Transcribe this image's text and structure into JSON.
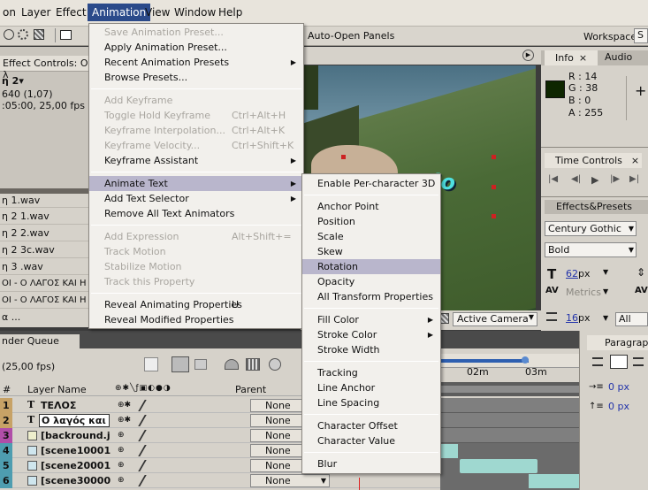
{
  "menubar": {
    "items": [
      "on",
      "Layer",
      "Effect",
      "Animation",
      "View",
      "Window",
      "Help"
    ],
    "active": "Animation"
  },
  "toolbar": {
    "auto_open_panels": "Auto-Open Panels",
    "workspace_label": "Workspace:",
    "workspace_value": "S"
  },
  "effect_controls": {
    "tab_title": "Effect Controls: Ο λ",
    "comp_name": "η 2▾",
    "size": "640 (1,07)",
    "duration": ":05:00, 25,00 fps"
  },
  "project_files": [
    "η 1.wav",
    "η 2 1.wav",
    "η 2 2.wav",
    "η 2 3c.wav",
    "η 3 .wav",
    "ΟΙ - Ο ΛΑΓΟΣ ΚΑΙ Η",
    "ΟΙ - Ο ΛΑΓΟΣ ΚΑΙ Η",
    "α ..."
  ],
  "render_queue": {
    "tab": "nder Queue",
    "fps": "(25,00 fps)"
  },
  "timeline": {
    "col_hash": "#",
    "col_layer_name": "Layer Name",
    "col_parent": "Parent",
    "markers": [
      "02m",
      "03m"
    ],
    "layers": [
      {
        "num": "1",
        "type": "T",
        "name": "ΤΕΛΟΣ",
        "parent": "None"
      },
      {
        "num": "2",
        "type": "T",
        "name": "Ο λαγός και η",
        "parent": "None"
      },
      {
        "num": "3",
        "type": "img",
        "name": "[backround.j",
        "parent": "None"
      },
      {
        "num": "4",
        "type": "img",
        "name": "[scene10001",
        "parent": "None"
      },
      {
        "num": "5",
        "type": "img",
        "name": "[scene20001",
        "parent": "None"
      },
      {
        "num": "6",
        "type": "img",
        "name": "[scene30000",
        "parent": "None"
      }
    ]
  },
  "viewer": {
    "camera": "Active Camera",
    "text_overlay": "sio"
  },
  "info_panel": {
    "tab_info": "Info",
    "tab_audio": "Audio",
    "r": "R : 14",
    "g": "G : 38",
    "b": "B : 0",
    "a": "A : 255",
    "swatch_color": "#0e2600"
  },
  "time_controls": {
    "title": "Time Controls"
  },
  "effects_presets": {
    "title": "Effects&Presets",
    "font": "Century Gothic",
    "style": "Bold",
    "size": "62",
    "size_unit": "px",
    "kerning": "Metrics",
    "leading": "16",
    "leading_unit": "px",
    "fill_option": "All Fills"
  },
  "paragraph_panel": {
    "title": "Paragraph",
    "indent1": "0 px",
    "indent2": "0 px"
  },
  "animation_menu": {
    "items": [
      {
        "label": "Save Animation Preset...",
        "disabled": true
      },
      {
        "label": "Apply Animation Preset...",
        "disabled": false
      },
      {
        "label": "Recent Animation Presets",
        "disabled": false,
        "submenu": true
      },
      {
        "label": "Browse Presets...",
        "disabled": false
      },
      {
        "label": "Add Keyframe",
        "disabled": true
      },
      {
        "label": "Toggle Hold Keyframe",
        "disabled": true,
        "shortcut": "Ctrl+Alt+H"
      },
      {
        "label": "Keyframe Interpolation...",
        "disabled": true,
        "shortcut": "Ctrl+Alt+K"
      },
      {
        "label": "Keyframe Velocity...",
        "disabled": true,
        "shortcut": "Ctrl+Shift+K"
      },
      {
        "label": "Keyframe Assistant",
        "disabled": false,
        "submenu": true
      },
      {
        "label": "Animate Text",
        "disabled": false,
        "submenu": true,
        "highlighted": true
      },
      {
        "label": "Add Text Selector",
        "disabled": false,
        "submenu": true
      },
      {
        "label": "Remove All Text Animators",
        "disabled": false
      },
      {
        "label": "Add Expression",
        "disabled": true,
        "shortcut": "Alt+Shift+="
      },
      {
        "label": "Track Motion",
        "disabled": true
      },
      {
        "label": "Stabilize Motion",
        "disabled": true
      },
      {
        "label": "Track this Property",
        "disabled": true
      },
      {
        "label": "Reveal Animating Properties",
        "disabled": false,
        "shortcut": "U"
      },
      {
        "label": "Reveal Modified Properties",
        "disabled": false
      }
    ]
  },
  "animate_text_submenu": {
    "items": [
      {
        "label": "Enable Per-character 3D"
      },
      {
        "label": "Anchor Point"
      },
      {
        "label": "Position"
      },
      {
        "label": "Scale"
      },
      {
        "label": "Skew"
      },
      {
        "label": "Rotation",
        "highlighted": true
      },
      {
        "label": "Opacity"
      },
      {
        "label": "All Transform Properties"
      },
      {
        "label": "Fill Color",
        "submenu": true
      },
      {
        "label": "Stroke Color",
        "submenu": true
      },
      {
        "label": "Stroke Width"
      },
      {
        "label": "Tracking"
      },
      {
        "label": "Line Anchor"
      },
      {
        "label": "Line Spacing"
      },
      {
        "label": "Character Offset"
      },
      {
        "label": "Character Value"
      },
      {
        "label": "Blur"
      }
    ]
  }
}
